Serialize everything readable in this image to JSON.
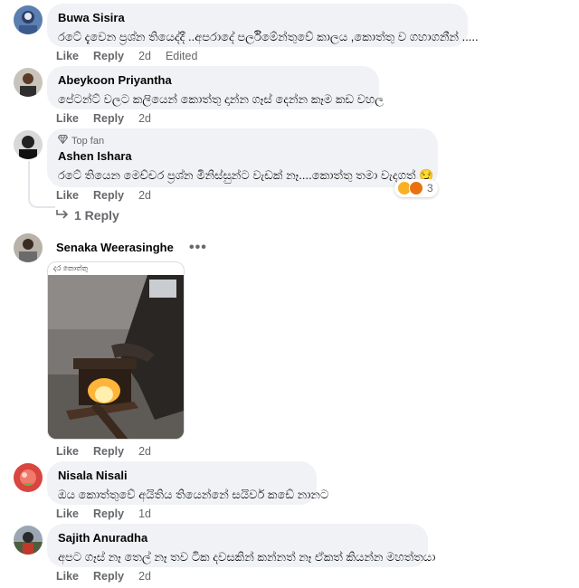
{
  "comments": [
    {
      "author": "Buwa Sisira",
      "text": "රටේ දැවෙන ප්‍රශ්න තියෙද්දී ..අපරාදේ පර්ලිමේන්තුවේ කාලය ,කොත්තු ව ගහාගනීන් .....",
      "like": "Like",
      "reply": "Reply",
      "time": "2d",
      "edited": "Edited"
    },
    {
      "author": "Abeykoon Priyantha",
      "text": "පේටන්ට් වලට කලියෙන් කොත්තු දාන්න ගෑස් දෙන්න කෑම කඩ වහල",
      "like": "Like",
      "reply": "Reply",
      "time": "2d"
    },
    {
      "badge": "Top fan",
      "author": "Ashen Ishara",
      "text": "රටේ තියෙන මෙච්චර ප්‍රශ්න මිනිස්සුන්ට වැඩක් නෑ....කොත්තු තමා වැදගත්",
      "emoji": "😏",
      "reaction_count": "3",
      "like": "Like",
      "reply": "Reply",
      "time": "2d",
      "replies_link": "1 Reply"
    },
    {
      "author": "Senaka Weerasinghe",
      "more": "•••",
      "photo_caption": "දර කොත්තු",
      "like": "Like",
      "reply": "Reply",
      "time": "2d"
    },
    {
      "author": "Nisala Nisali",
      "text": "ඔය කොත්තුවේ අයිතිය තියෙන්නේ සයිවර් කඩේ නානට",
      "like": "Like",
      "reply": "Reply",
      "time": "1d"
    },
    {
      "author": "Sajith Anuradha",
      "text": "අපට ගෑස් නෑ තෙල් නෑ තව ටික දවසකින් කන්නත් නෑ ඒකත් කියන්න මහත්තයා",
      "like": "Like",
      "reply": "Reply",
      "time": "2d"
    }
  ],
  "colors": {
    "bubble": "#f0f2f5",
    "secondary_text": "#65676b",
    "primary_text": "#050505",
    "reaction_haha": "#f7b125",
    "reaction_angry": "#e9710f"
  },
  "icons": {
    "top_fan": "diamond-icon",
    "reply_arrow": "reply-arrow-icon",
    "reactions": [
      "haha-reaction-icon",
      "angry-reaction-icon"
    ]
  }
}
